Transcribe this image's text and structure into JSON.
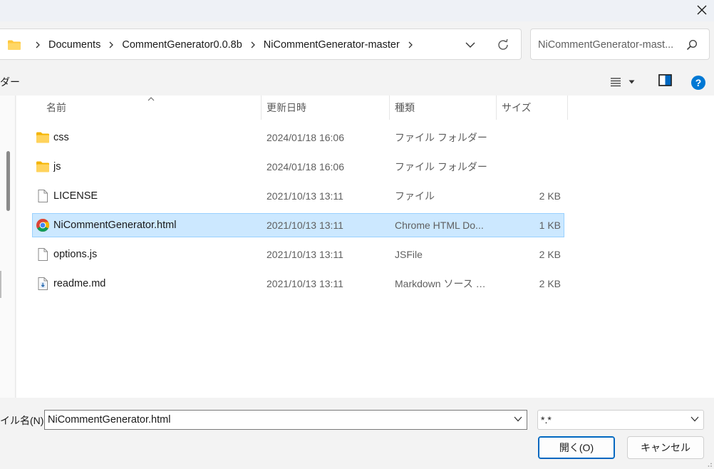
{
  "window": {
    "close_label": "×"
  },
  "address": {
    "breadcrumbs": [
      "Documents",
      "CommentGenerator0.0.8b",
      "NiCommentGenerator-master"
    ]
  },
  "search": {
    "placeholder": "NiCommentGenerator-mast..."
  },
  "toolbar": {
    "new_folder_label": "ダー"
  },
  "columns": {
    "name": "名前",
    "date": "更新日時",
    "type": "種類",
    "size": "サイズ"
  },
  "files": [
    {
      "name": "css",
      "date": "2024/01/18 16:06",
      "type": "ファイル フォルダー",
      "size": "",
      "icon": "folder-icon",
      "selected": false
    },
    {
      "name": "js",
      "date": "2024/01/18 16:06",
      "type": "ファイル フォルダー",
      "size": "",
      "icon": "folder-icon",
      "selected": false
    },
    {
      "name": "LICENSE",
      "date": "2021/10/13 13:11",
      "type": "ファイル",
      "size": "2 KB",
      "icon": "file-icon",
      "selected": false
    },
    {
      "name": "NiCommentGenerator.html",
      "date": "2021/10/13 13:11",
      "type": "Chrome HTML Do...",
      "size": "1 KB",
      "icon": "chrome-icon",
      "selected": true
    },
    {
      "name": "options.js",
      "date": "2021/10/13 13:11",
      "type": "JSFile",
      "size": "2 KB",
      "icon": "file-icon",
      "selected": false
    },
    {
      "name": "readme.md",
      "date": "2021/10/13 13:11",
      "type": "Markdown ソース フ...",
      "size": "2 KB",
      "icon": "markdown-file-icon",
      "selected": false
    }
  ],
  "bottom": {
    "filename_label": "イル名(N):",
    "filename_value": "NiCommentGenerator.html",
    "filetype_value": "*.*",
    "open_label": "開く(O)",
    "cancel_label": "キャンセル"
  },
  "colors": {
    "selection_bg": "#cce8ff",
    "selection_border": "#99d1ff",
    "accent": "#0067c0",
    "folder": "#ffc83d",
    "help": "#0078d4"
  }
}
